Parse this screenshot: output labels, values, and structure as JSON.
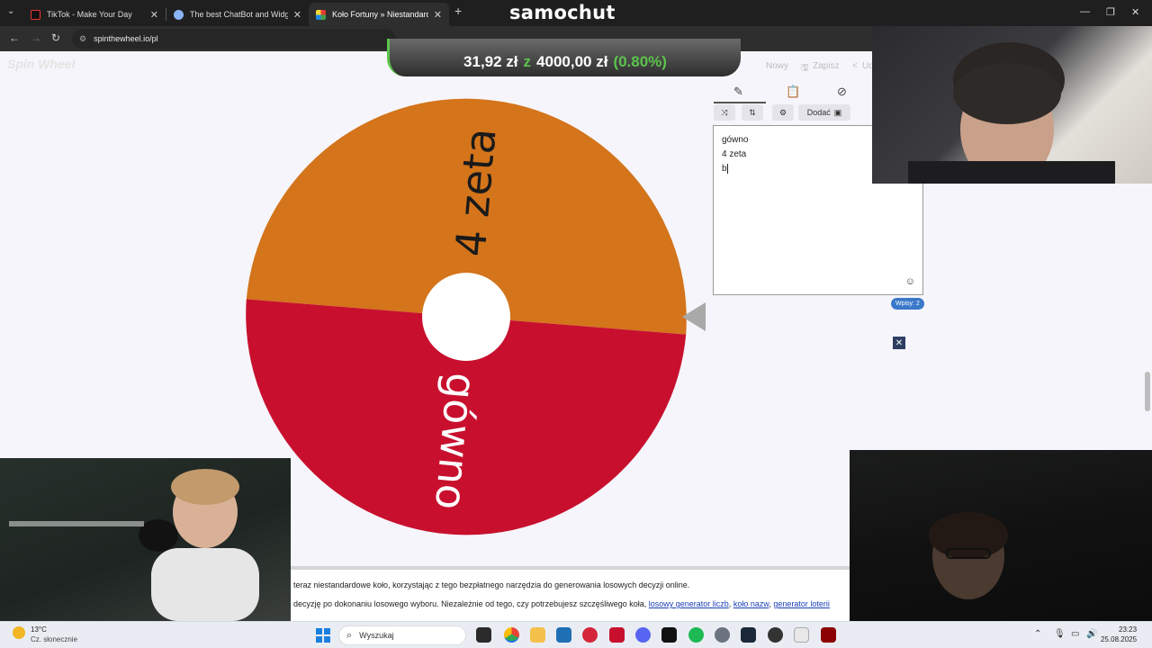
{
  "browser": {
    "tabs": [
      {
        "label": "TikTok - Make Your Day",
        "icon": "tiktok-icon"
      },
      {
        "label": "The best ChatBot and Widgets",
        "icon": "chatbot-icon"
      },
      {
        "label": "Koło Fortuny » Niestandardowy",
        "icon": "wheel-icon"
      }
    ],
    "url": "spinthewheel.io/pl",
    "overlay_title": "samochut"
  },
  "donation": {
    "current": "31,92 zł",
    "sep": "z",
    "goal": "4000,00 zł",
    "percent": "(0.80%)"
  },
  "site": {
    "logo": "Spin Wheel",
    "top_buttons": {
      "new": "Nowy",
      "save": "Zapisz",
      "more": "Ud"
    }
  },
  "wheel": {
    "segments": [
      {
        "label": "4 zeta",
        "color": "#d4741b"
      },
      {
        "label": "gówno",
        "color": "#c8102e"
      }
    ]
  },
  "editor": {
    "add_label": "Dodać",
    "entries": [
      "gówno",
      "4 zeta",
      "b"
    ],
    "count_label": "Wpisy: 2"
  },
  "footer": {
    "line1": "teraz niestandardowe koło, korzystając z tego bezpłatnego narzędzia do generowania losowych decyzji online.",
    "line2_prefix": "decyzję po dokonaniu losowego wyboru. Niezależnie od tego, czy potrzebujesz szczęśliwego koła,",
    "links": [
      "losowy generator liczb",
      "koło nazw",
      "generator loterii"
    ]
  },
  "taskbar": {
    "weather_temp": "13°C",
    "weather_desc": "Cz. słonecznie",
    "search_placeholder": "Wyszukaj",
    "time": "23:23",
    "date": "25.08.2025"
  },
  "colors": {
    "accent_green": "#5bc44b",
    "link_blue": "#1a3fb7",
    "badge_blue": "#3a78c9"
  }
}
